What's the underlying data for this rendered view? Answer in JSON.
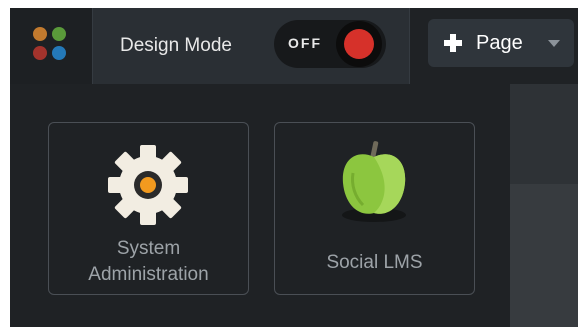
{
  "header": {
    "logo_icon": "four-dots-logo-icon",
    "design_mode": {
      "label": "Design Mode",
      "toggle_state": "OFF",
      "toggle_color": "#d6312a"
    },
    "page_button": {
      "icon": "plus-icon",
      "label": "Page",
      "caret_icon": "caret-down-icon"
    }
  },
  "tiles": [
    {
      "icon": "gear-icon",
      "label_line1": "System",
      "label_line2": "Administration"
    },
    {
      "icon": "apple-icon",
      "label": "Social LMS"
    }
  ],
  "colors": {
    "background": "#1f2225",
    "gear_center": "#f29a1f",
    "apple_green": "#8cc63f"
  }
}
